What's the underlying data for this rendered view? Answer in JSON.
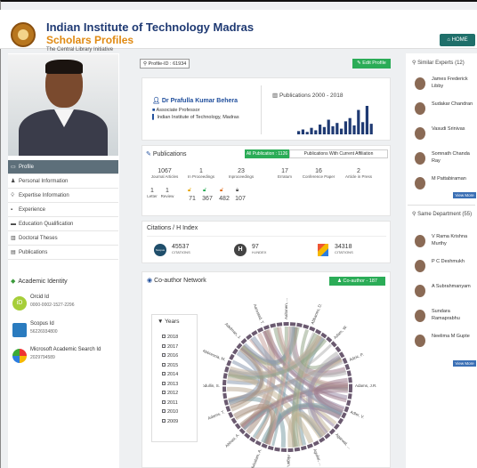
{
  "header": {
    "title": "Indian Institute of Technology Madras",
    "subtitle": "Scholars Profiles",
    "tagline": "The Central Library Initiative",
    "home_label": "HOME"
  },
  "profile": {
    "profile_id": "Profile-ID : 61934",
    "edit_label": "Edit Profile",
    "name": "Dr Prafulla Kumar Behera",
    "role": "Associate Professor",
    "institute": "Indian Institute of Technology, Madras",
    "pub_chart_title": "Publications 2000 - 2018"
  },
  "pub_chart": {
    "values": [
      4,
      6,
      3,
      8,
      5,
      12,
      9,
      18,
      10,
      14,
      7,
      16,
      20,
      11,
      30,
      15,
      35,
      13
    ]
  },
  "menu": [
    {
      "label": "Profile",
      "icon": "monitor-icon"
    },
    {
      "label": "Personal Information",
      "icon": "person-icon"
    },
    {
      "label": "Expertise Information",
      "icon": "bulb-icon"
    },
    {
      "label": "Experience",
      "icon": "briefcase-icon"
    },
    {
      "label": "Education Qualification",
      "icon": "graduation-icon"
    },
    {
      "label": "Doctoral Theses",
      "icon": "book-icon"
    },
    {
      "label": "Publications",
      "icon": "file-icon"
    }
  ],
  "academic": {
    "title": "Academic Identity",
    "items": [
      {
        "name": "Orcid Id",
        "value": "0000-0002-1527-2296"
      },
      {
        "name": "Scopus Id",
        "value": "56226934800"
      },
      {
        "name": "Microsoft Academic Search Id",
        "value": "2029794589"
      }
    ]
  },
  "publications": {
    "title": "Publications",
    "tab_all": "All Publication : 1126",
    "tab_current": "Publications With Current Affiliation",
    "stats": [
      {
        "num": "1067",
        "label": "Journal Articles"
      },
      {
        "num": "1",
        "label": "In Proceedings"
      },
      {
        "num": "23",
        "label": "Inproceedings"
      },
      {
        "num": "17",
        "label": "Erratum"
      },
      {
        "num": "16",
        "label": "Conference Paper"
      },
      {
        "num": "2",
        "label": "Article in Press"
      }
    ],
    "stats2": [
      {
        "num": "1",
        "label": "Letter"
      },
      {
        "num": "1",
        "label": "Review"
      }
    ],
    "open": [
      "71",
      "367",
      "482",
      "107"
    ]
  },
  "citations": {
    "title": "Citations / H Index",
    "scopus": "45537",
    "scopus_label": "CITATIONS",
    "scopus_logo": "Scopus",
    "hindex": "97",
    "hindex_label": "H-INDEX",
    "hindex_logo": "H",
    "other": "34318",
    "other_label": "CITATIONS"
  },
  "coauthor": {
    "title": "Co-author Network",
    "button": "Co-author - 187",
    "years_title": "Years",
    "years": [
      "2018",
      "2017",
      "2016",
      "2015",
      "2014",
      "2013",
      "2012",
      "2011",
      "2010",
      "2009"
    ],
    "left_names": [
      "Aaltonen, ...",
      "Abbaneo, D.",
      "Adam, W.",
      "Adzic, P.",
      "Adams, J.R.",
      "Adler, V.",
      "Agarwal, ...",
      "Aguilar, ..."
    ],
    "right_names": [
      "Akgun, B.",
      "Abdulsalam, A.",
      "Abbasi, A.",
      "Adams, T.",
      "Abdullin, S.",
      "Abbrescia, M.",
      "Adelman, J.",
      "Aarestad, T."
    ]
  },
  "right": {
    "similar_title": "Similar Experts (12)",
    "similar": [
      "James Frederick Libby",
      "Sudakar Chandran",
      "Vasudi Srinivas",
      "Somnath Chanda Ray",
      "M Pattabiraman"
    ],
    "dept_title": "Same Department (55)",
    "dept": [
      "V Rama Krishna Murthy",
      "P C Deshmukh",
      "A Subrahmanyam",
      "Sundara Ramaprabhu",
      "Neelima M Gupte"
    ],
    "view_more": "View More"
  },
  "colors": {
    "accent": "#2bac57",
    "header_blue": "#1f3a73",
    "orange": "#e08a12",
    "home": "#1f6f6a"
  }
}
